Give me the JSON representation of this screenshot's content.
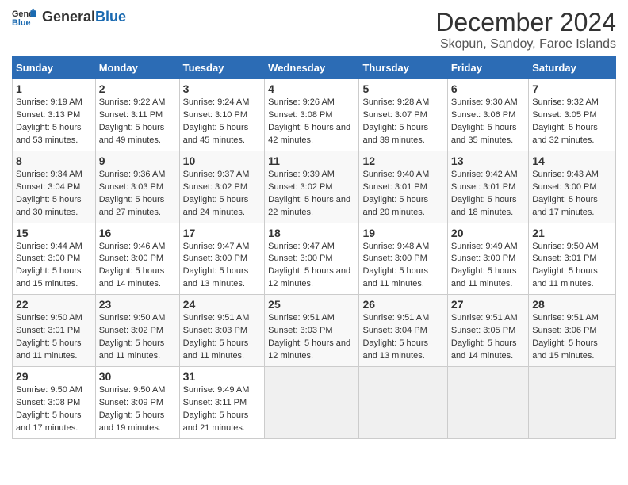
{
  "logo": {
    "general": "General",
    "blue": "Blue"
  },
  "title": "December 2024",
  "subtitle": "Skopun, Sandoy, Faroe Islands",
  "weekdays": [
    "Sunday",
    "Monday",
    "Tuesday",
    "Wednesday",
    "Thursday",
    "Friday",
    "Saturday"
  ],
  "weeks": [
    [
      {
        "day": "1",
        "sunrise": "Sunrise: 9:19 AM",
        "sunset": "Sunset: 3:13 PM",
        "daylight": "Daylight: 5 hours and 53 minutes."
      },
      {
        "day": "2",
        "sunrise": "Sunrise: 9:22 AM",
        "sunset": "Sunset: 3:11 PM",
        "daylight": "Daylight: 5 hours and 49 minutes."
      },
      {
        "day": "3",
        "sunrise": "Sunrise: 9:24 AM",
        "sunset": "Sunset: 3:10 PM",
        "daylight": "Daylight: 5 hours and 45 minutes."
      },
      {
        "day": "4",
        "sunrise": "Sunrise: 9:26 AM",
        "sunset": "Sunset: 3:08 PM",
        "daylight": "Daylight: 5 hours and 42 minutes."
      },
      {
        "day": "5",
        "sunrise": "Sunrise: 9:28 AM",
        "sunset": "Sunset: 3:07 PM",
        "daylight": "Daylight: 5 hours and 39 minutes."
      },
      {
        "day": "6",
        "sunrise": "Sunrise: 9:30 AM",
        "sunset": "Sunset: 3:06 PM",
        "daylight": "Daylight: 5 hours and 35 minutes."
      },
      {
        "day": "7",
        "sunrise": "Sunrise: 9:32 AM",
        "sunset": "Sunset: 3:05 PM",
        "daylight": "Daylight: 5 hours and 32 minutes."
      }
    ],
    [
      {
        "day": "8",
        "sunrise": "Sunrise: 9:34 AM",
        "sunset": "Sunset: 3:04 PM",
        "daylight": "Daylight: 5 hours and 30 minutes."
      },
      {
        "day": "9",
        "sunrise": "Sunrise: 9:36 AM",
        "sunset": "Sunset: 3:03 PM",
        "daylight": "Daylight: 5 hours and 27 minutes."
      },
      {
        "day": "10",
        "sunrise": "Sunrise: 9:37 AM",
        "sunset": "Sunset: 3:02 PM",
        "daylight": "Daylight: 5 hours and 24 minutes."
      },
      {
        "day": "11",
        "sunrise": "Sunrise: 9:39 AM",
        "sunset": "Sunset: 3:02 PM",
        "daylight": "Daylight: 5 hours and 22 minutes."
      },
      {
        "day": "12",
        "sunrise": "Sunrise: 9:40 AM",
        "sunset": "Sunset: 3:01 PM",
        "daylight": "Daylight: 5 hours and 20 minutes."
      },
      {
        "day": "13",
        "sunrise": "Sunrise: 9:42 AM",
        "sunset": "Sunset: 3:01 PM",
        "daylight": "Daylight: 5 hours and 18 minutes."
      },
      {
        "day": "14",
        "sunrise": "Sunrise: 9:43 AM",
        "sunset": "Sunset: 3:00 PM",
        "daylight": "Daylight: 5 hours and 17 minutes."
      }
    ],
    [
      {
        "day": "15",
        "sunrise": "Sunrise: 9:44 AM",
        "sunset": "Sunset: 3:00 PM",
        "daylight": "Daylight: 5 hours and 15 minutes."
      },
      {
        "day": "16",
        "sunrise": "Sunrise: 9:46 AM",
        "sunset": "Sunset: 3:00 PM",
        "daylight": "Daylight: 5 hours and 14 minutes."
      },
      {
        "day": "17",
        "sunrise": "Sunrise: 9:47 AM",
        "sunset": "Sunset: 3:00 PM",
        "daylight": "Daylight: 5 hours and 13 minutes."
      },
      {
        "day": "18",
        "sunrise": "Sunrise: 9:47 AM",
        "sunset": "Sunset: 3:00 PM",
        "daylight": "Daylight: 5 hours and 12 minutes."
      },
      {
        "day": "19",
        "sunrise": "Sunrise: 9:48 AM",
        "sunset": "Sunset: 3:00 PM",
        "daylight": "Daylight: 5 hours and 11 minutes."
      },
      {
        "day": "20",
        "sunrise": "Sunrise: 9:49 AM",
        "sunset": "Sunset: 3:00 PM",
        "daylight": "Daylight: 5 hours and 11 minutes."
      },
      {
        "day": "21",
        "sunrise": "Sunrise: 9:50 AM",
        "sunset": "Sunset: 3:01 PM",
        "daylight": "Daylight: 5 hours and 11 minutes."
      }
    ],
    [
      {
        "day": "22",
        "sunrise": "Sunrise: 9:50 AM",
        "sunset": "Sunset: 3:01 PM",
        "daylight": "Daylight: 5 hours and 11 minutes."
      },
      {
        "day": "23",
        "sunrise": "Sunrise: 9:50 AM",
        "sunset": "Sunset: 3:02 PM",
        "daylight": "Daylight: 5 hours and 11 minutes."
      },
      {
        "day": "24",
        "sunrise": "Sunrise: 9:51 AM",
        "sunset": "Sunset: 3:03 PM",
        "daylight": "Daylight: 5 hours and 11 minutes."
      },
      {
        "day": "25",
        "sunrise": "Sunrise: 9:51 AM",
        "sunset": "Sunset: 3:03 PM",
        "daylight": "Daylight: 5 hours and 12 minutes."
      },
      {
        "day": "26",
        "sunrise": "Sunrise: 9:51 AM",
        "sunset": "Sunset: 3:04 PM",
        "daylight": "Daylight: 5 hours and 13 minutes."
      },
      {
        "day": "27",
        "sunrise": "Sunrise: 9:51 AM",
        "sunset": "Sunset: 3:05 PM",
        "daylight": "Daylight: 5 hours and 14 minutes."
      },
      {
        "day": "28",
        "sunrise": "Sunrise: 9:51 AM",
        "sunset": "Sunset: 3:06 PM",
        "daylight": "Daylight: 5 hours and 15 minutes."
      }
    ],
    [
      {
        "day": "29",
        "sunrise": "Sunrise: 9:50 AM",
        "sunset": "Sunset: 3:08 PM",
        "daylight": "Daylight: 5 hours and 17 minutes."
      },
      {
        "day": "30",
        "sunrise": "Sunrise: 9:50 AM",
        "sunset": "Sunset: 3:09 PM",
        "daylight": "Daylight: 5 hours and 19 minutes."
      },
      {
        "day": "31",
        "sunrise": "Sunrise: 9:49 AM",
        "sunset": "Sunset: 3:11 PM",
        "daylight": "Daylight: 5 hours and 21 minutes."
      },
      null,
      null,
      null,
      null
    ]
  ]
}
